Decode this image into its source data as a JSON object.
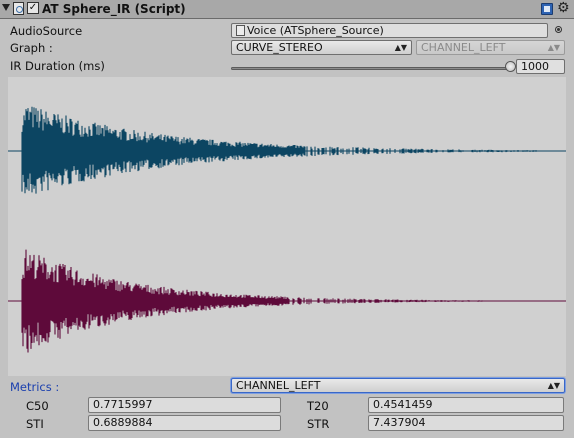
{
  "header": {
    "title": "AT Sphere_IR (Script)",
    "enabled": true
  },
  "fields": {
    "audio_source": {
      "label": "AudioSource",
      "value": "Voice (ATSphere_Source)"
    },
    "graph": {
      "label": "Graph :",
      "value": "CURVE_STEREO",
      "channel": "CHANNEL_LEFT"
    },
    "ir_duration": {
      "label": "IR Duration (ms)",
      "value": "1000",
      "slider_fraction": 1.0
    }
  },
  "waveform": {
    "channels": [
      {
        "name": "left",
        "color": "#0c4562"
      },
      {
        "name": "right",
        "color": "#5e0a3a"
      }
    ],
    "background": "#d0d0d0"
  },
  "metrics": {
    "label": "Metrics :",
    "channel": "CHANNEL_LEFT",
    "items": [
      {
        "name": "C50",
        "value": "0.7715997"
      },
      {
        "name": "T20",
        "value": "0.4541459"
      },
      {
        "name": "STI",
        "value": "0.6889884"
      },
      {
        "name": "STR",
        "value": "7.437904"
      }
    ]
  }
}
